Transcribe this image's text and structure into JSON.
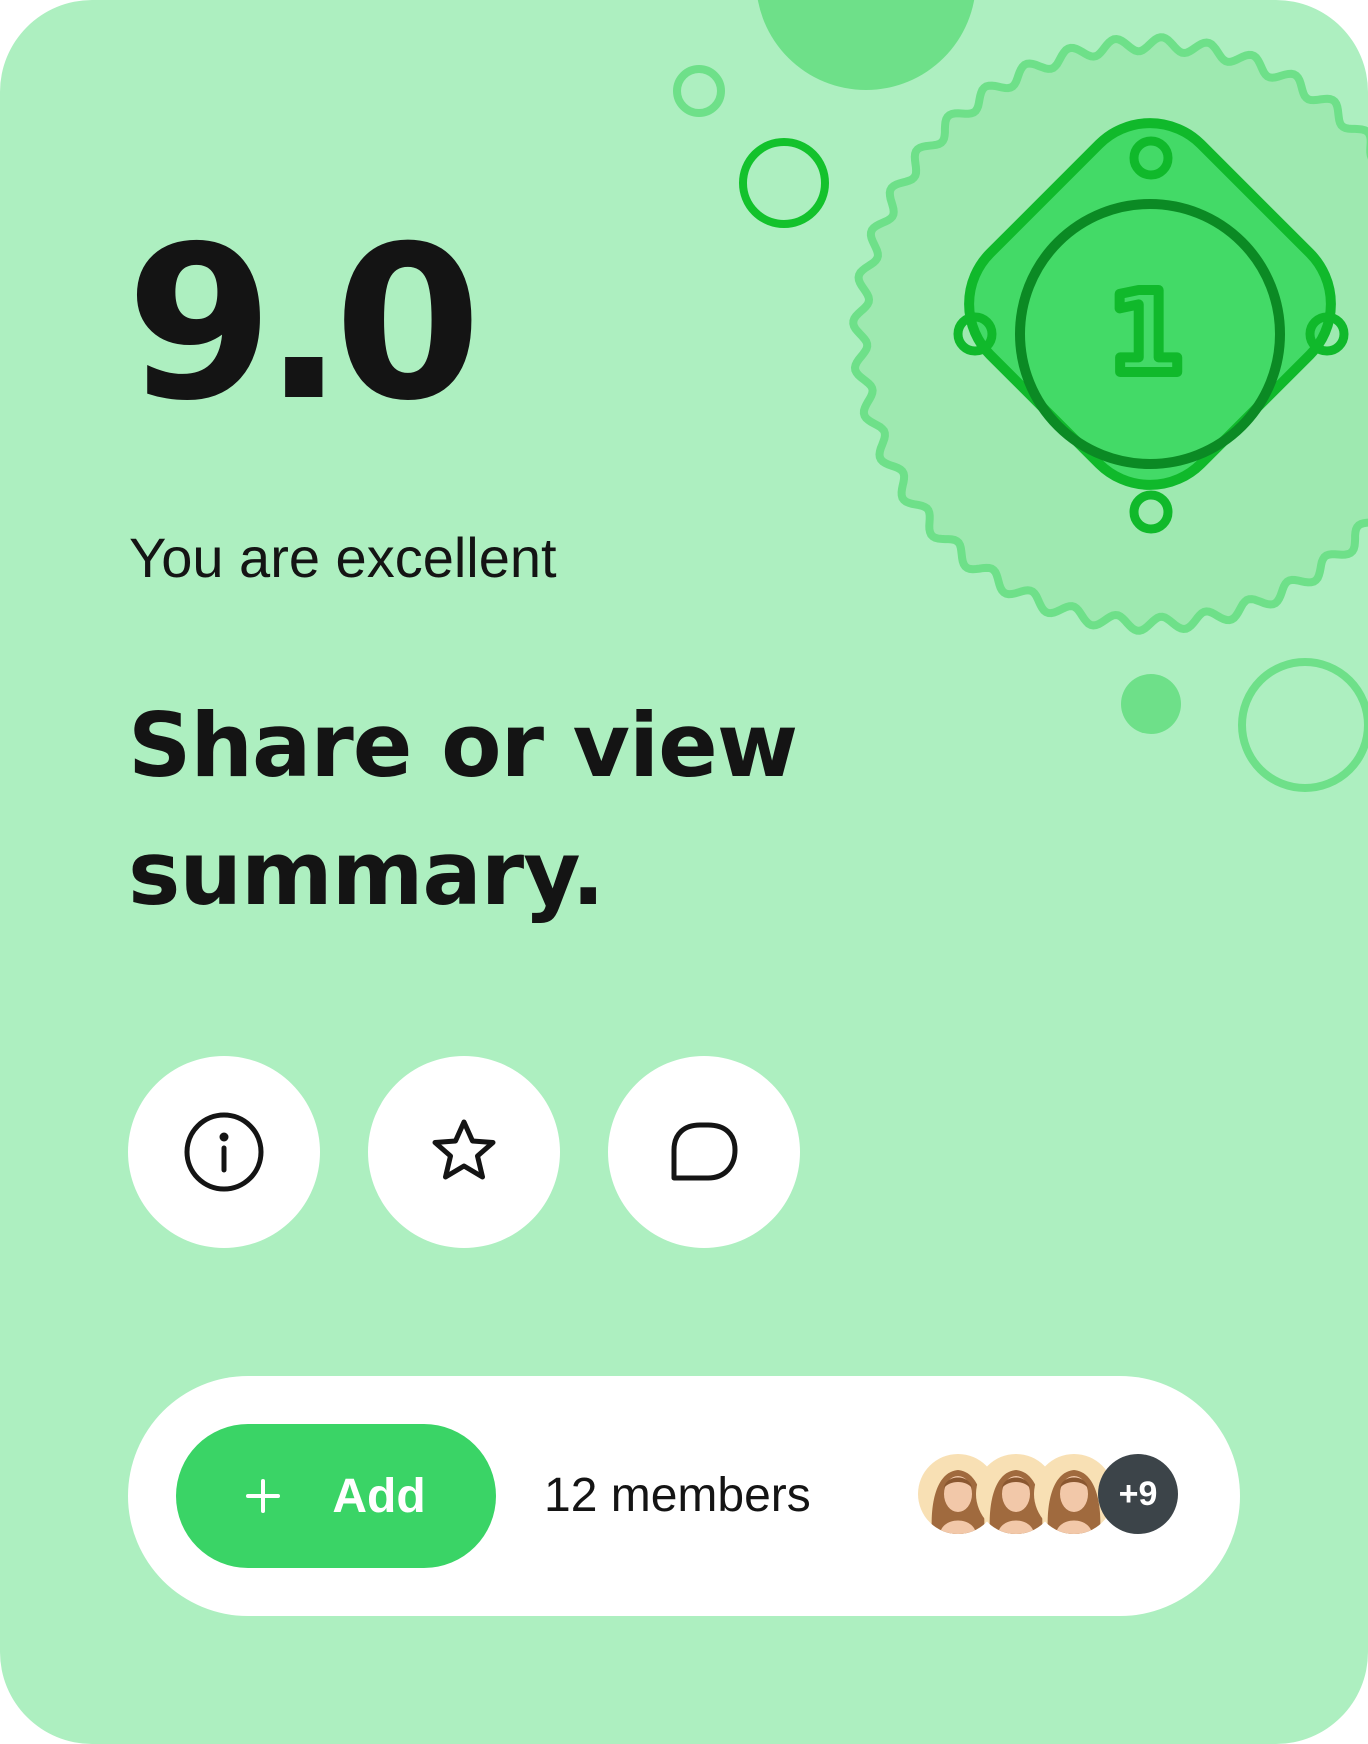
{
  "score": "9.0",
  "subtitle": "You are excellent",
  "headline": "Share or view summary.",
  "badge": {
    "number": "1"
  },
  "actions": [
    {
      "icon": "info-icon"
    },
    {
      "icon": "star-icon"
    },
    {
      "icon": "chat-bubble-icon"
    }
  ],
  "bottom_bar": {
    "add_label": "Add",
    "members_label": "12 members",
    "more_count": "+9"
  },
  "colors": {
    "background": "#adefc0",
    "accent": "#3ad466",
    "badge_dark": "#10b92b",
    "text": "#141414"
  }
}
